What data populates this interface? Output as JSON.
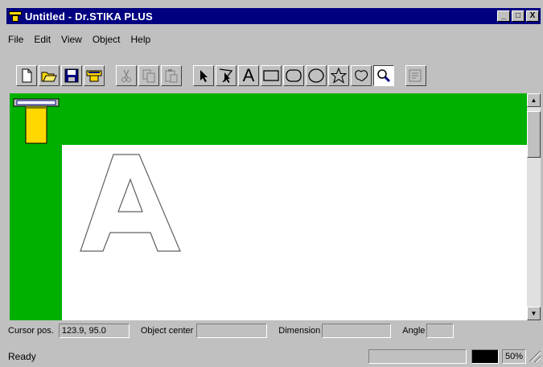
{
  "window": {
    "title": "Untitled - Dr.STIKA PLUS",
    "controls": [
      "_",
      "□",
      "X"
    ]
  },
  "menu": [
    "File",
    "Edit",
    "View",
    "Object",
    "Help"
  ],
  "toolbar": {
    "tools": [
      {
        "name": "new-file-icon",
        "enabled": true
      },
      {
        "name": "open-folder-icon",
        "enabled": true
      },
      {
        "name": "save-disk-icon",
        "enabled": true
      },
      {
        "name": "plotter-output-icon",
        "enabled": true
      },
      {
        "name": "cut-icon",
        "enabled": false
      },
      {
        "name": "copy-icon",
        "enabled": false
      },
      {
        "name": "paste-icon",
        "enabled": false
      },
      {
        "name": "select-arrow-icon",
        "enabled": true
      },
      {
        "name": "node-edit-icon",
        "enabled": true
      },
      {
        "name": "text-tool-icon",
        "enabled": true,
        "glyph": "A"
      },
      {
        "name": "rectangle-tool-icon",
        "enabled": true
      },
      {
        "name": "rounded-rectangle-tool-icon",
        "enabled": true
      },
      {
        "name": "ellipse-tool-icon",
        "enabled": true
      },
      {
        "name": "star-tool-icon",
        "enabled": true
      },
      {
        "name": "freeform-shape-tool-icon",
        "enabled": true
      },
      {
        "name": "zoom-tool-icon",
        "enabled": true,
        "pressed": true
      },
      {
        "name": "properties-icon",
        "enabled": false
      }
    ]
  },
  "canvas": {
    "text_object": "A",
    "ruler_color": "#00b000"
  },
  "status": {
    "cursor_label": "Cursor pos.",
    "cursor_value": "123.9, 95.0",
    "object_center_label": "Object center",
    "object_center_value": "",
    "dimension_label": "Dimension",
    "dimension_value": "",
    "angle_label": "Angle",
    "angle_value": "",
    "ready_text": "Ready",
    "zoom": "50%"
  },
  "colors": {
    "titlebar": "#000080",
    "accent": "#ffd800",
    "ruler": "#00b000"
  }
}
